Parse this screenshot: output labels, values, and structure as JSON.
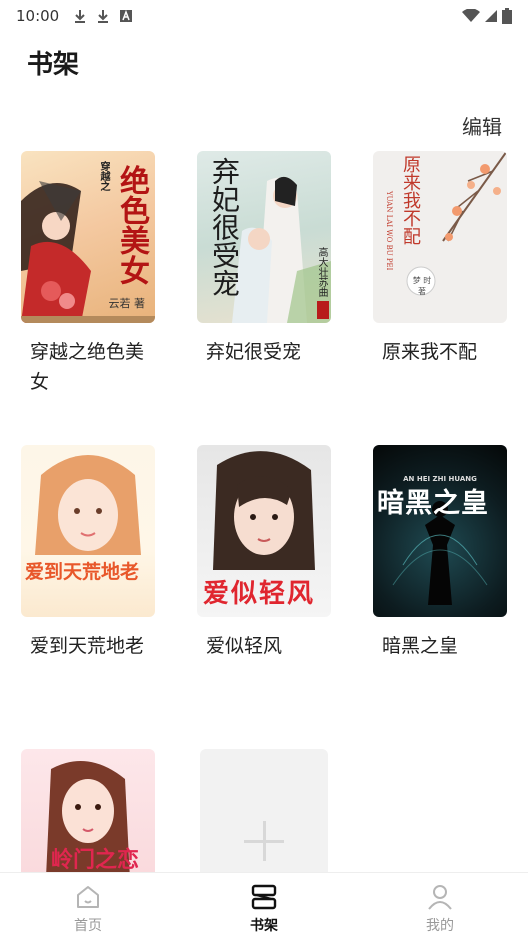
{
  "status_bar": {
    "time": "10:00"
  },
  "header": {
    "title": "书架"
  },
  "toolbar": {
    "edit_label": "编辑"
  },
  "books": [
    {
      "title": "穿越之绝色美女",
      "cover_text": "绝色美女",
      "cover_sub": "穿越之",
      "author": "云若 著"
    },
    {
      "title": "弃妃很受宠",
      "cover_text": "弃妃很受宠",
      "cover_sub": "高大壮苏曲"
    },
    {
      "title": "原来我不配",
      "cover_text": "原来我不配",
      "cover_sub": "YUAN LAI WO BU PEI",
      "author": "梦 时 著"
    },
    {
      "title": "爱到天荒地老",
      "cover_text": "爱到天荒地老"
    },
    {
      "title": "爱似轻风",
      "cover_text": "爱似轻风"
    },
    {
      "title": "暗黑之皇",
      "cover_text": "暗黑之皇",
      "cover_sub": "AN HEI ZHI HUANG"
    },
    {
      "title": "",
      "cover_text": ""
    }
  ],
  "add_book": {
    "icon": "plus-icon"
  },
  "bottom_nav": [
    {
      "label": "首页",
      "icon": "home-icon",
      "active": false
    },
    {
      "label": "书架",
      "icon": "bookshelf-icon",
      "active": true
    },
    {
      "label": "我的",
      "icon": "user-icon",
      "active": false
    }
  ]
}
